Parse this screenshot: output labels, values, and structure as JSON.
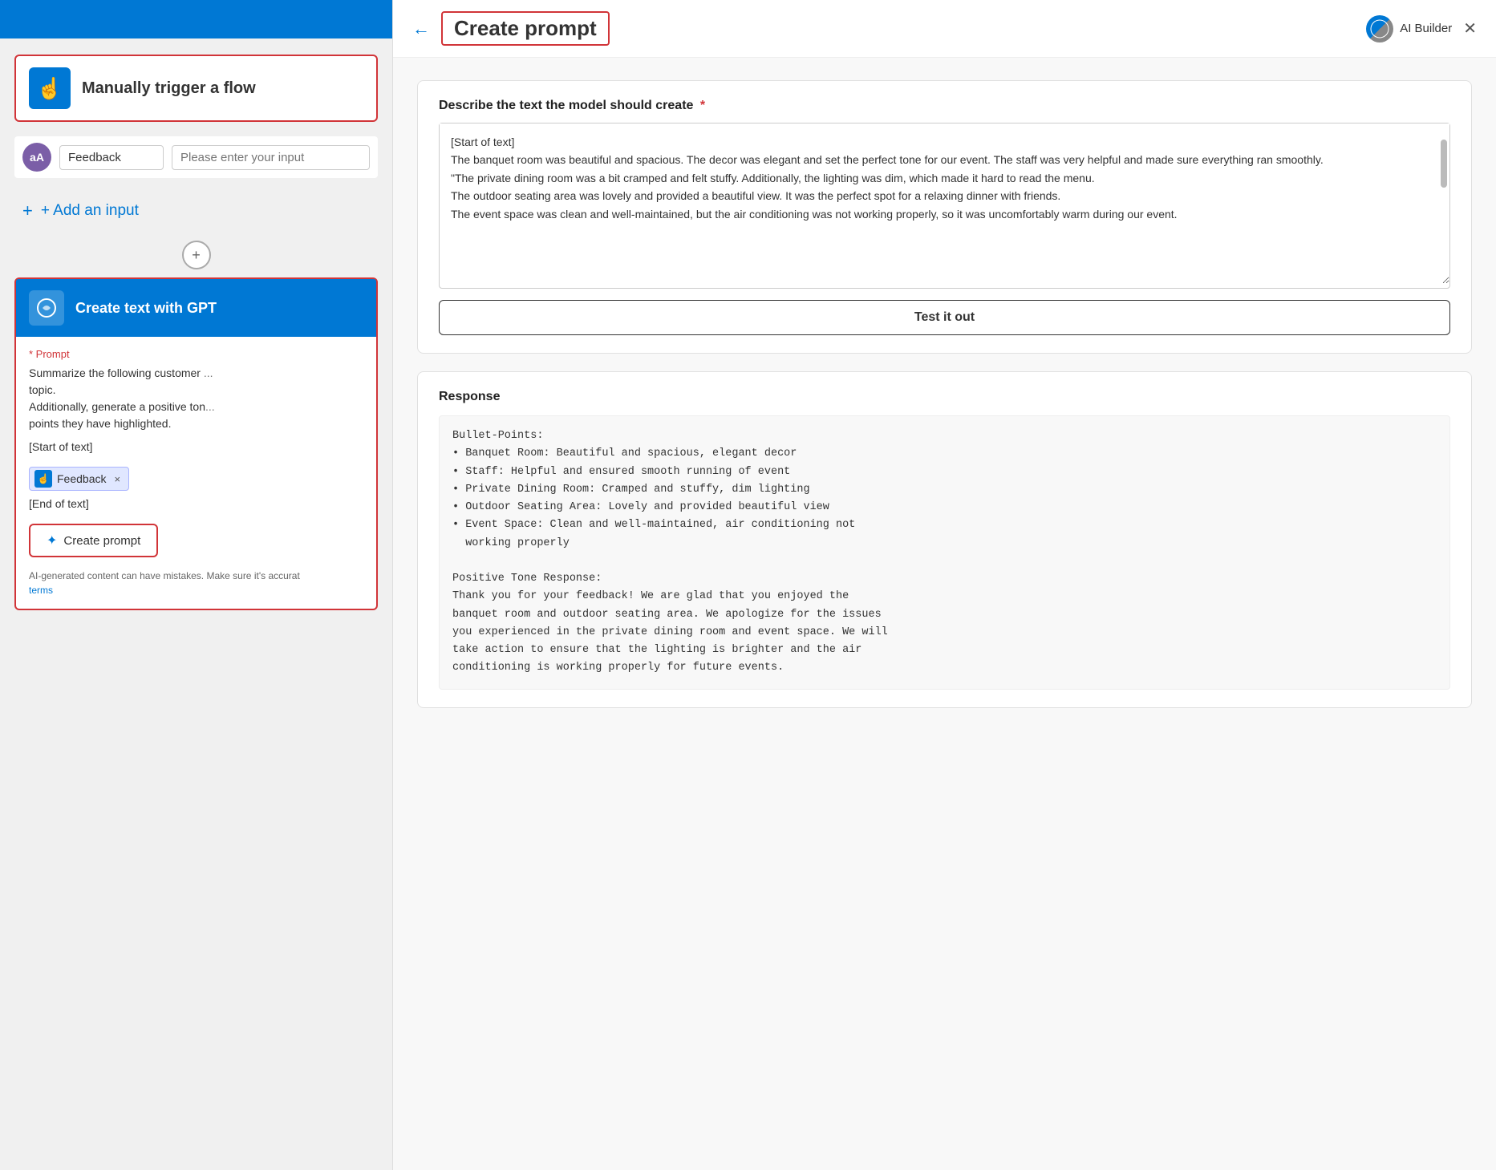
{
  "left": {
    "trigger": {
      "title": "Manually trigger a flow",
      "icon": "☝"
    },
    "feedback_label": "Feedback",
    "placeholder": "Please enter your input",
    "avatar_initials": "aA",
    "add_input": "+ Add an input",
    "gpt_title": "Create text with GPT",
    "gpt_icon": "⚡",
    "prompt_label": "* Prompt",
    "prompt_lines": [
      "Summarize the following customer",
      "topic.",
      "Additionally, generate a positive ton",
      "points they have highlighted."
    ],
    "start_text": "[Start of text]",
    "end_text": "[End of text]",
    "feedback_tag": "Feedback",
    "create_prompt_btn": "Create prompt",
    "ai_note": "AI-generated content can have mistakes. Make sure it's accurat",
    "terms_link": "terms"
  },
  "right": {
    "back_btn": "←",
    "page_title": "Create prompt",
    "ai_builder": "AI Builder",
    "close_btn": "✕",
    "describe_label": "Describe the text the model should create",
    "describe_text": "[Start of text]\nThe banquet room was beautiful and spacious. The decor was elegant and set the perfect tone for our event. The staff was very helpful and made sure everything ran smoothly.\n\"The private dining room was a bit cramped and felt stuffy. Additionally, the lighting was dim, which made it hard to read the menu.\nThe outdoor seating area was lovely and provided a beautiful view. It was the perfect spot for a relaxing dinner with friends.\nThe event space was clean and well-maintained, but the air conditioning was not working properly, so it was uncomfortably warm during our event.",
    "test_btn": "Test it out",
    "response_label": "Response",
    "response_text": "Bullet-Points:\n• Banquet Room: Beautiful and spacious, elegant decor\n• Staff: Helpful and ensured smooth running of event\n• Private Dining Room: Cramped and stuffy, dim lighting\n• Outdoor Seating Area: Lovely and provided beautiful view\n• Event Space: Clean and well-maintained, air conditioning not\n  working properly\n\nPositive Tone Response:\nThank you for your feedback! We are glad that you enjoyed the\nbanquet room and outdoor seating area. We apologize for the issues\nyou experienced in the private dining room and event space. We will\ntake action to ensure that the lighting is brighter and the air\nconditioning is working properly for future events."
  }
}
